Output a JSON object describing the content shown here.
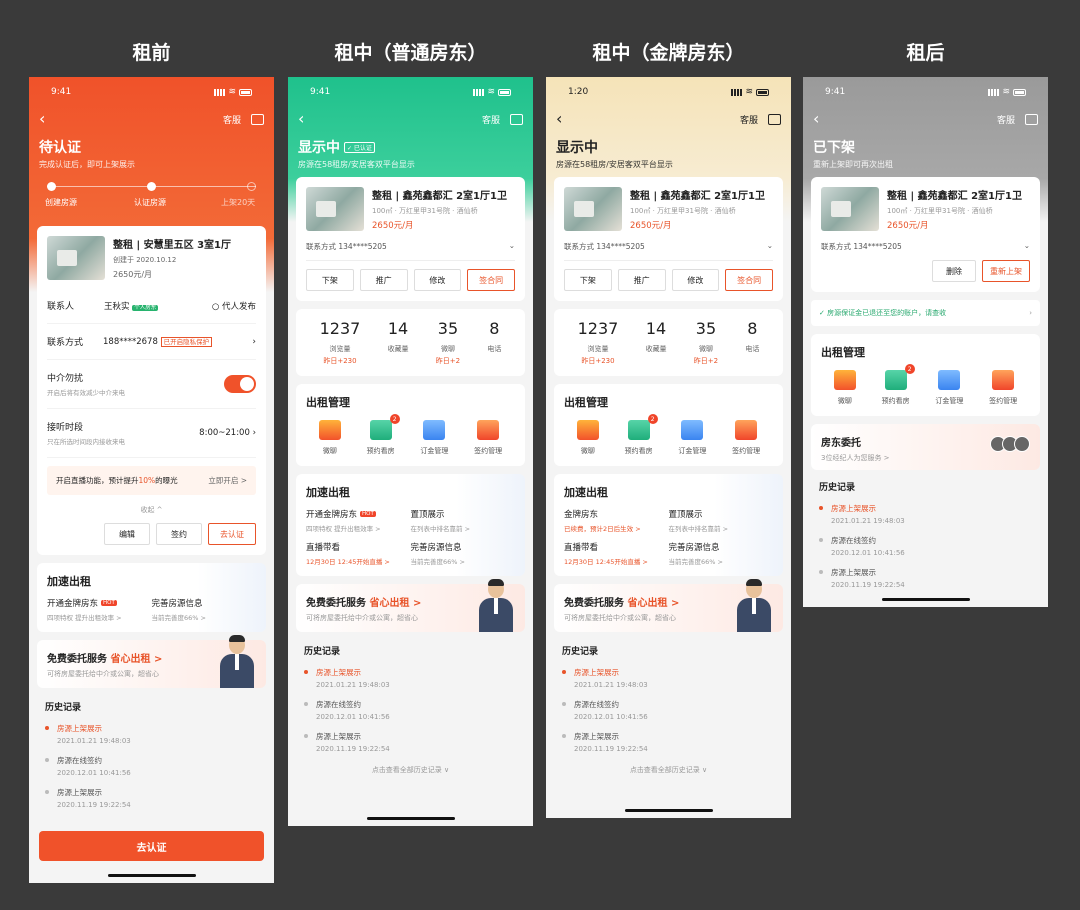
{
  "stages": [
    "租前",
    "租中（普通房东）",
    "租中（金牌房东）",
    "租后"
  ],
  "p1": {
    "time": "9:41",
    "service": "客服",
    "title": "待认证",
    "subtitle": "完成认证后，即可上架展示",
    "steps": [
      "创建房源",
      "认证房源",
      "上架20天"
    ],
    "listing_title": "整租 | 安慧里五区 3室1厅",
    "created": "创建于 2020.10.12",
    "price": "2650元/月",
    "contact_label": "联系人",
    "contact_name": "王秋实",
    "contact_tag": "个人房东",
    "proxy": "代人发布",
    "phone_label": "联系方式",
    "phone": "188****2678",
    "privacy": "已开启隐私保护",
    "agent_label": "中介勿扰",
    "agent_sub": "开启后将有效减少中介来电",
    "hours_label": "接听时段",
    "hours_sub": "只在所选时间段内接收来电",
    "hours": "8:00~21:00",
    "tip_a": "开启直播功能，预计提升",
    "tip_b": "10%",
    "tip_c": "的曝光",
    "tip_open": "立即开启 >",
    "collapse": "收起 ^",
    "btn_edit": "编辑",
    "btn_sign": "签约",
    "btn_verify": "去认证",
    "speed_title": "加速出租",
    "sp1_t": "开通金牌房东",
    "sp1_s": "四项特权 提升出租效率 >",
    "sp2_t": "完善房源信息",
    "sp2_s": "当前完善度66% >",
    "hot": "HOT",
    "entrust_t": "免费委托服务",
    "entrust_hl": "省心出租 >",
    "entrust_s": "可将房屋委托给中介或公寓，超省心",
    "hist_title": "历史记录",
    "h1a": "房源上架展示",
    "h1b": "2021.01.21 19:48:03",
    "h2a": "房源在线签约",
    "h2b": "2020.12.01 10:41:56",
    "h3a": "房源上架展示",
    "h3b": "2020.11.19 19:22:54",
    "bottom_btn": "去认证"
  },
  "common": {
    "listing_title": "整租 | 鑫苑鑫都汇 2室1厅1卫",
    "listing_sub": "100㎡ · 万红里甲31号院 · 酒仙桥",
    "price": "2650元/月",
    "contact": "联系方式 134****5205",
    "btn_down": "下架",
    "btn_promote": "推广",
    "btn_edit": "修改",
    "btn_contract": "签合同",
    "views": "1237",
    "views_l": "浏览量",
    "views_d": "昨日+230",
    "fav": "14",
    "fav_l": "收藏量",
    "chat": "35",
    "chat_l": "微聊",
    "chat_d": "昨日+2",
    "call": "8",
    "call_l": "电话",
    "mgmt_title": "出租管理",
    "i1": "微聊",
    "i2": "预约看房",
    "i3": "订金管理",
    "i4": "签约管理",
    "badge": "2",
    "speed_title": "加速出租",
    "top_t": "置顶展示",
    "top_s": "在列表中排名靠前 >",
    "live_t": "直播带看",
    "live_s": "12月30日 12:45开始直播 >",
    "info_t": "完善房源信息",
    "info_s": "当前完善度66% >",
    "more": "点击查看全部历史记录 ∨"
  },
  "p2": {
    "time": "9:41",
    "title": "显示中",
    "verified": "✓ 已认证",
    "subtitle": "房源在58租房/安居客双平台显示",
    "gold_t": "开通金牌房东",
    "gold_s": "四项特权 提升出租效率 >"
  },
  "p3": {
    "time": "1:20",
    "title": "显示中",
    "subtitle": "房源在58租房/安居客双平台显示",
    "gold_t": "金牌房东",
    "gold_s": "已续费，预计2日后生效 >"
  },
  "p4": {
    "time": "9:41",
    "title": "已下架",
    "subtitle": "重新上架即可再次出租",
    "btn_delete": "删除",
    "btn_relist": "重新上架",
    "notice": "房源保证金已退还至您的账户，请查收",
    "landlord_t": "房东委托",
    "landlord_s": "3位经纪人为您服务 >"
  },
  "colors": {
    "orange": "#f0522a",
    "green": "#1fc18c",
    "gold": "#f5e3b8",
    "gray": "#9a9a9a"
  }
}
